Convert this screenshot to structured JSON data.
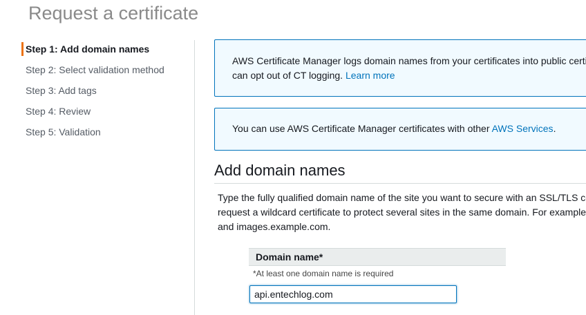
{
  "page": {
    "title": "Request a certificate"
  },
  "steps": [
    {
      "label": "Step 1: Add domain names",
      "active": true
    },
    {
      "label": "Step 2: Select validation method"
    },
    {
      "label": "Step 3: Add tags"
    },
    {
      "label": "Step 4: Review"
    },
    {
      "label": "Step 5: Validation"
    }
  ],
  "info_boxes": {
    "ct_logging": {
      "line1": "AWS Certificate Manager logs domain names from your certificates into public certi",
      "line2_text": "can opt out of CT logging.",
      "link": "Learn more"
    },
    "services": {
      "text": "You can use AWS Certificate Manager certificates with other",
      "link": "AWS Services",
      "trailing": "."
    }
  },
  "section": {
    "title": "Add domain names",
    "description_lines": [
      "Type the fully qualified domain name of the site you want to secure with an SSL/TLS ce",
      "request a wildcard certificate to protect several sites in the same domain. For example",
      "and images.example.com."
    ]
  },
  "domain_table": {
    "header": "Domain name*",
    "required_note": "*At least one domain name is required",
    "input_value": "api.entechlog.com"
  },
  "colors": {
    "accent": "#ec7211",
    "link": "#0073bb",
    "info_bg": "#f1faff",
    "info_border": "#0073bb"
  }
}
